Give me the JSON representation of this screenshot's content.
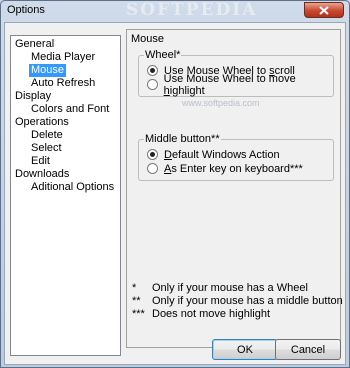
{
  "window": {
    "title": "Options",
    "watermark": "SOFTPEDIA"
  },
  "tree": {
    "items": [
      {
        "label": "General"
      },
      {
        "label": "Media Player"
      },
      {
        "label": "Mouse"
      },
      {
        "label": "Auto Refresh"
      },
      {
        "label": "Display"
      },
      {
        "label": "Colors and Font"
      },
      {
        "label": "Operations"
      },
      {
        "label": "Delete"
      },
      {
        "label": "Select"
      },
      {
        "label": "Edit"
      },
      {
        "label": "Downloads"
      },
      {
        "label": "Aditional Options"
      }
    ],
    "selected": "Mouse"
  },
  "page": {
    "title": "Mouse",
    "wheel": {
      "label": "Wheel*",
      "opt1_pre": "Use Mouse Wheel to ",
      "opt1_u": "s",
      "opt1_post": "croll",
      "opt2_pre": "Use Mouse Wheel to move ",
      "opt2_u": "h",
      "opt2_post": "ighlight",
      "selected": 1
    },
    "middle": {
      "label": "Middle button**",
      "opt1_pre": "",
      "opt1_u": "D",
      "opt1_post": "efault Windows Action",
      "opt2_pre": "",
      "opt2_u": "A",
      "opt2_post": "s Enter key on keyboard***",
      "selected": 1
    },
    "footnotes": [
      {
        "mark": "*",
        "text": "Only if your mouse has a Wheel"
      },
      {
        "mark": "**",
        "text": "Only if your mouse has a middle button"
      },
      {
        "mark": "***",
        "text": "Does not move highlight"
      }
    ],
    "overlay_watermark": "www.softpedia.com"
  },
  "buttons": {
    "ok": "OK",
    "cancel": "Cancel"
  }
}
